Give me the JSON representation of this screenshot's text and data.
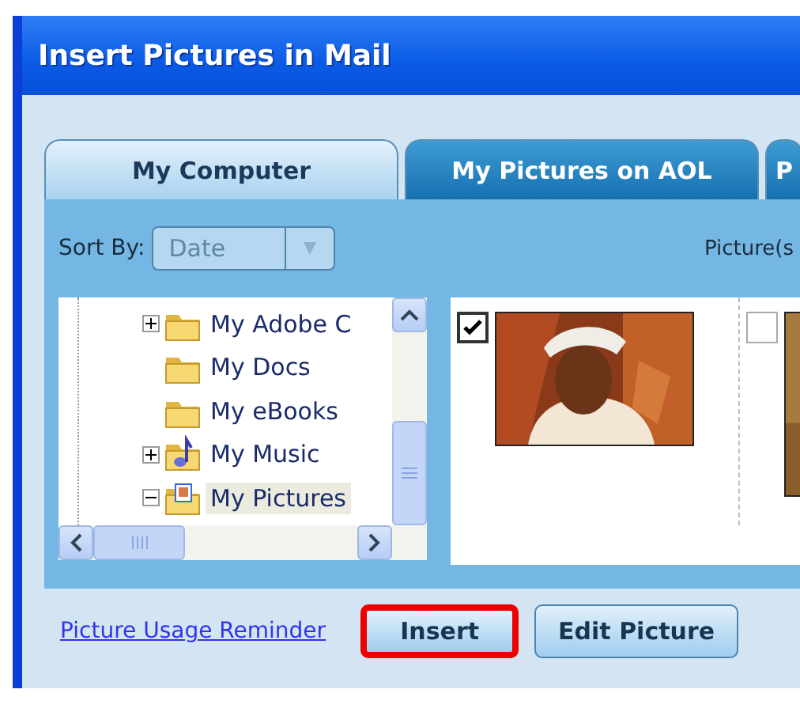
{
  "window": {
    "title": "Insert Pictures in Mail"
  },
  "tabs": [
    {
      "label": "My Computer",
      "selected": true
    },
    {
      "label": "My Pictures on AOL",
      "selected": false
    },
    {
      "label": "P",
      "selected": false
    }
  ],
  "sort": {
    "label": "Sort By:",
    "value": "Date",
    "disabled": true
  },
  "picture_count_label": "Picture(s",
  "tree": {
    "items": [
      {
        "label": "My Adobe C",
        "kind": "folder",
        "expanded": false,
        "selected": false
      },
      {
        "label": "My Docs",
        "kind": "folder",
        "selected": false
      },
      {
        "label": "My eBooks",
        "kind": "folder",
        "selected": false
      },
      {
        "label": "My Music",
        "kind": "music",
        "expanded": false,
        "selected": false
      },
      {
        "label": "My Pictures",
        "kind": "pictures",
        "expanded": true,
        "selected": true
      }
    ]
  },
  "thumbnails": [
    {
      "checked": true,
      "kind": "picture"
    },
    {
      "checked": false,
      "kind": "picture"
    }
  ],
  "footer": {
    "link": "Picture Usage Reminder",
    "buttons": [
      {
        "label": "Insert",
        "highlighted": true
      },
      {
        "label": "Edit Picture",
        "highlighted": false
      }
    ]
  }
}
